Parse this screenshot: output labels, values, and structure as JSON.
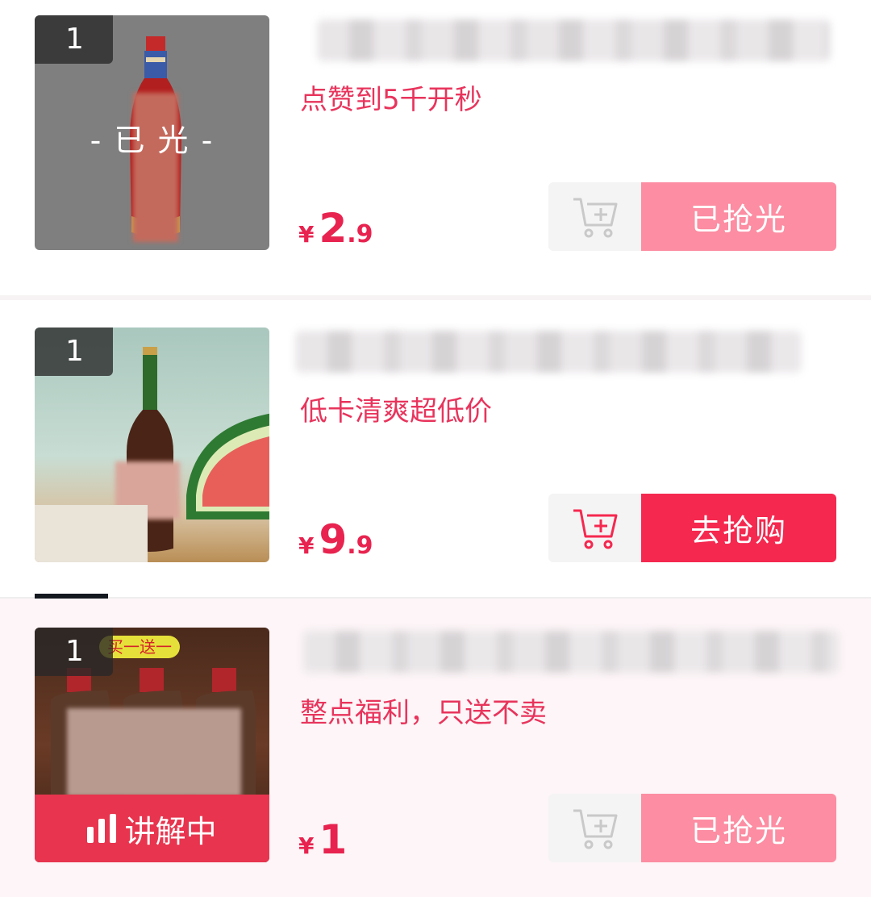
{
  "products": [
    {
      "rank": "1",
      "overlay_text": "- 已   光 -",
      "subtitle": "点赞到5千开秒",
      "price": {
        "currency": "¥",
        "integer": "2",
        "decimal": ".9"
      },
      "action_label": "已抢光",
      "state": "sold-out"
    },
    {
      "rank": "1",
      "subtitle": "低卡清爽超低价",
      "price": {
        "currency": "¥",
        "integer": "9",
        "decimal": ".9"
      },
      "action_label": "去抢购",
      "state": "available"
    },
    {
      "rank": "1",
      "promo_tag": "买一送一",
      "live_label": "讲解中",
      "subtitle": "整点福利，只送不卖",
      "price": {
        "currency": "¥",
        "integer": "1",
        "decimal": ""
      },
      "action_label": "已抢光",
      "state": "sold-out"
    }
  ],
  "icons": {
    "cart": "add-to-cart-icon",
    "live": "live-audio-bars-icon"
  },
  "colors": {
    "accent": "#f5284f",
    "sold_out": "#fc8da2",
    "price": "#e8234f",
    "subtitle": "#e8345c",
    "live_bar": "#e8344e"
  }
}
